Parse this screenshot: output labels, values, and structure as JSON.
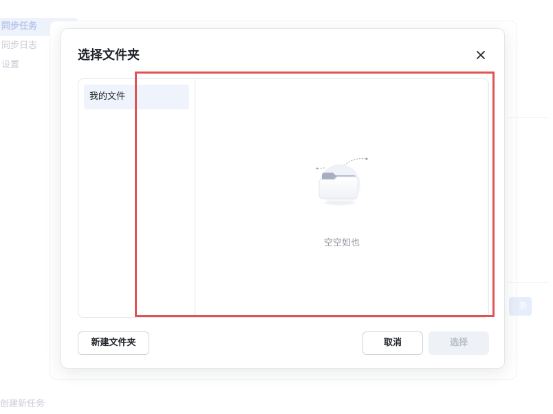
{
  "background": {
    "sidebar_items": [
      {
        "label": "同步任务",
        "active": true
      },
      {
        "label": "同步日志",
        "active": false
      },
      {
        "label": "设置",
        "active": false
      }
    ],
    "right_button_fragment": "务",
    "footer_text": "创建新任务"
  },
  "dialog": {
    "title": "选择文件夹",
    "close_icon": "close-icon",
    "tree": {
      "items": [
        {
          "label": "我的文件",
          "selected": true
        }
      ]
    },
    "empty_state": {
      "icon": "empty-folder-icon",
      "text": "空空如也"
    },
    "buttons": {
      "new_folder": "新建文件夹",
      "cancel": "取消",
      "select": "选择"
    }
  },
  "colors": {
    "highlight": "#e05353",
    "selected_item_bg": "#eef3fc",
    "disabled_button_bg": "#eef1f6",
    "border": "#e4e6ea"
  }
}
